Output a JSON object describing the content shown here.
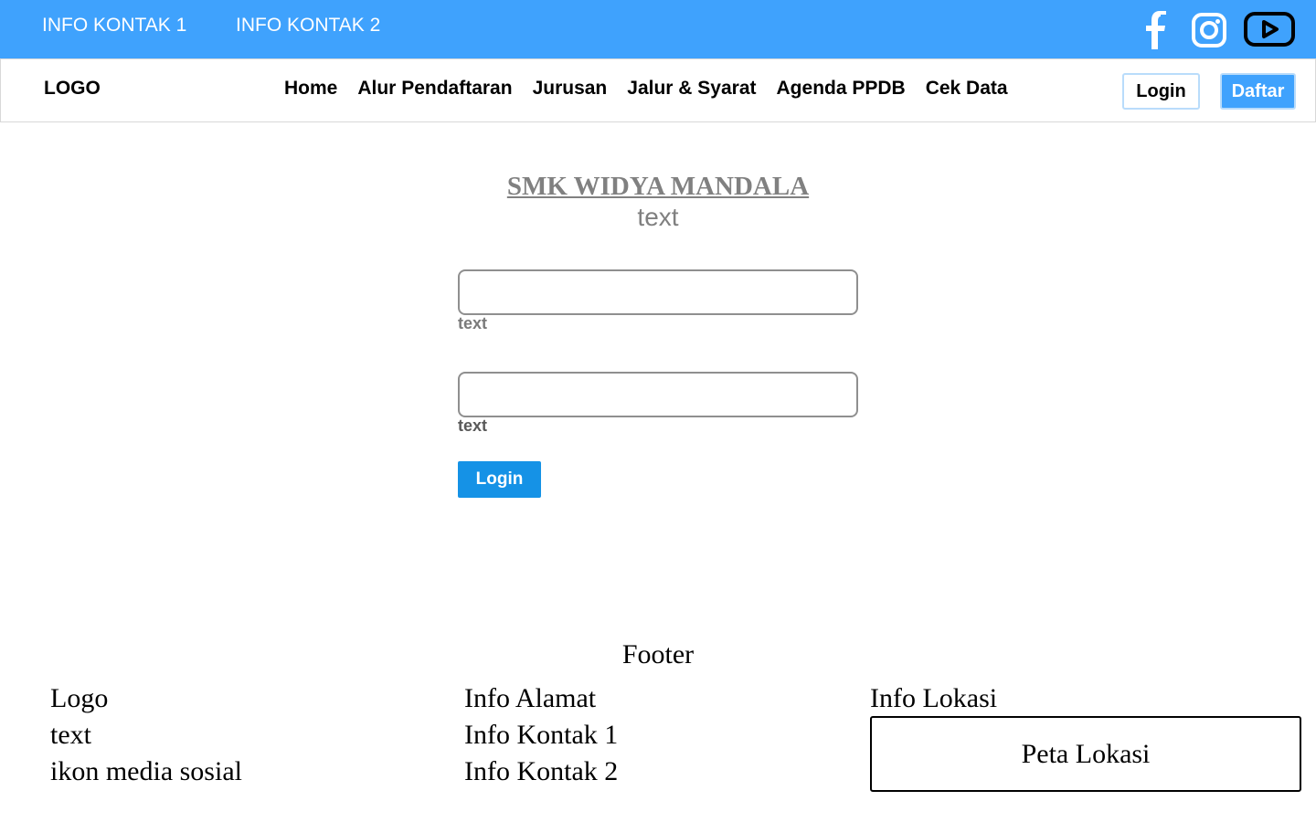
{
  "topbar": {
    "info_1": "INFO KONTAK 1",
    "info_2": "INFO KONTAK 2",
    "bg_color": "#3fa2fd",
    "social_icons": [
      "facebook-icon",
      "instagram-icon",
      "youtube-icon"
    ]
  },
  "nav": {
    "logo": "LOGO",
    "items": [
      {
        "label": "Home"
      },
      {
        "label": "Alur Pendaftaran"
      },
      {
        "label": "Jurusan"
      },
      {
        "label": "Jalur & Syarat"
      },
      {
        "label": "Agenda PPDB"
      },
      {
        "label": "Cek Data"
      }
    ],
    "login_label": "Login",
    "daftar_label": "Daftar"
  },
  "main": {
    "title": "SMK WIDYA MANDALA",
    "subtitle": "text",
    "field_1_label": "text",
    "field_2_label": "text",
    "field_1_value": "",
    "field_2_value": "",
    "login_button": "Login",
    "login_button_color": "#1592e6"
  },
  "footer": {
    "title": "Footer",
    "col1": [
      "Logo",
      "text",
      "ikon media sosial"
    ],
    "col2": [
      "Info Alamat",
      "Info Kontak 1",
      "Info Kontak 2"
    ],
    "col3_title": "Info Lokasi",
    "map_label": "Peta Lokasi"
  }
}
